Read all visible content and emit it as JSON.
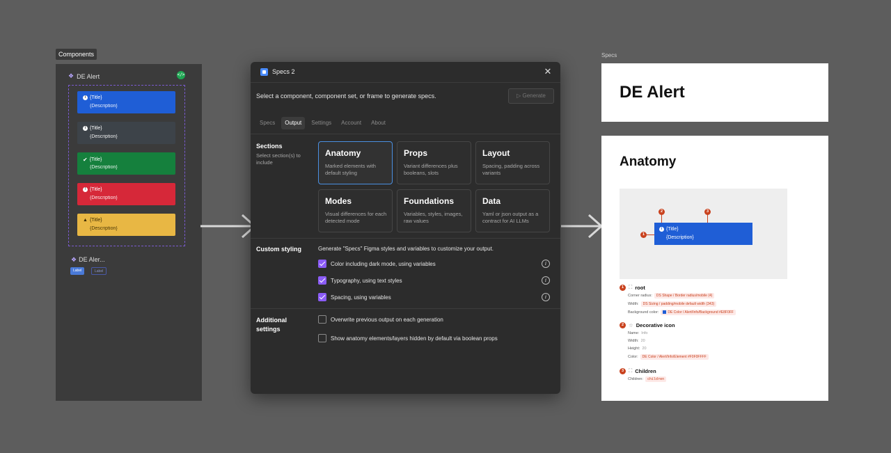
{
  "canvas": {
    "components_tag": "Components",
    "component_set_name": "DE Alert",
    "code_badge": "</>",
    "alerts": [
      {
        "title": "{Title}",
        "description": "{Description}",
        "variant": "info",
        "color": "#1f5ed6",
        "icon": "info-icon",
        "icon_glyph": "i"
      },
      {
        "title": "{Title}",
        "description": "{Description}",
        "variant": "neutral",
        "color": "#3d4349",
        "icon": "info-icon",
        "icon_glyph": "i"
      },
      {
        "title": "{Title}",
        "description": "{Description}",
        "variant": "success",
        "color": "#15803d",
        "icon": "check-icon",
        "icon_glyph": "✔"
      },
      {
        "title": "{Title}",
        "description": "{Description}",
        "variant": "error",
        "color": "#d62839",
        "icon": "error-icon",
        "icon_glyph": "!"
      },
      {
        "title": "{Title}",
        "description": "{Description}",
        "variant": "warning",
        "color": "#e8b744",
        "icon": "warning-icon",
        "icon_glyph": "▲"
      }
    ],
    "instance_name": "DE Aler...",
    "instance_pills": [
      "Label",
      "Label"
    ],
    "specs_tag": "Specs"
  },
  "dialog": {
    "title": "Specs 2",
    "close_glyph": "✕",
    "instruction": "Select a component, component set, or frame to generate specs.",
    "generate_label": "▷ Generate",
    "tabs": [
      "Specs",
      "Output",
      "Settings",
      "Account",
      "About"
    ],
    "active_tab": "Output",
    "sections": {
      "heading": "Sections",
      "subheading": "Select section(s) to include",
      "cards": [
        {
          "title": "Anatomy",
          "description": "Marked elements with default styling",
          "selected": true
        },
        {
          "title": "Props",
          "description": "Variant differences plus booleans, slots",
          "selected": false
        },
        {
          "title": "Layout",
          "description": "Spacing, padding across variants",
          "selected": false
        },
        {
          "title": "Modes",
          "description": "Visual differences for each detected mode",
          "selected": false
        },
        {
          "title": "Foundations",
          "description": "Variables, styles, images, raw values",
          "selected": false
        },
        {
          "title": "Data",
          "description": "Yaml or json output as a contract for AI LLMs",
          "selected": false
        }
      ]
    },
    "custom_styling": {
      "heading": "Custom styling",
      "description": "Generate \"Specs\" Figma styles and variables to customize your output.",
      "options": [
        {
          "label": "Color including dark mode, using variables",
          "checked": true
        },
        {
          "label": "Typography, using text styles",
          "checked": true
        },
        {
          "label": "Spacing, using variables",
          "checked": true
        }
      ],
      "info_glyph": "i"
    },
    "additional": {
      "heading_line1": "Additional",
      "heading_line2": "settings",
      "options": [
        {
          "label": "Overwrite previous output on each generation",
          "checked": false
        },
        {
          "label": "Show anatomy elements/layers hidden by default via boolean props",
          "checked": false
        }
      ]
    }
  },
  "spec_output": {
    "page_title": "DE Alert",
    "anatomy_title": "Anatomy",
    "preview": {
      "title": "{Title}",
      "description": "{Description}",
      "markers": [
        "1",
        "2",
        "3"
      ]
    },
    "items": [
      {
        "num": "1",
        "name": "root",
        "icon_glyph": "⛶",
        "rows": [
          {
            "label": "Corner radius:",
            "token": "DS Shape / Border radius/mobile (4)"
          },
          {
            "label": "Width:",
            "token": "DS Sizing / padding/mobile default width (343)"
          },
          {
            "label": "Background color:",
            "token": "DE Color / Alert/Info/Background #E8F0FF"
          }
        ]
      },
      {
        "num": "2",
        "name": "Decorative icon",
        "icon_glyph": "☆",
        "rows": [
          {
            "label": "Name:",
            "value": "Info"
          },
          {
            "label": "Width:",
            "value": "20"
          },
          {
            "label": "Height:",
            "value": "20"
          },
          {
            "label": "Color:",
            "token": "DE Color / Alert/Info/Element #F0F0FFFF"
          }
        ]
      },
      {
        "num": "3",
        "name": "Children",
        "icon_glyph": "⛶",
        "rows": [
          {
            "label": "Children:",
            "token": "children"
          }
        ]
      }
    ]
  }
}
